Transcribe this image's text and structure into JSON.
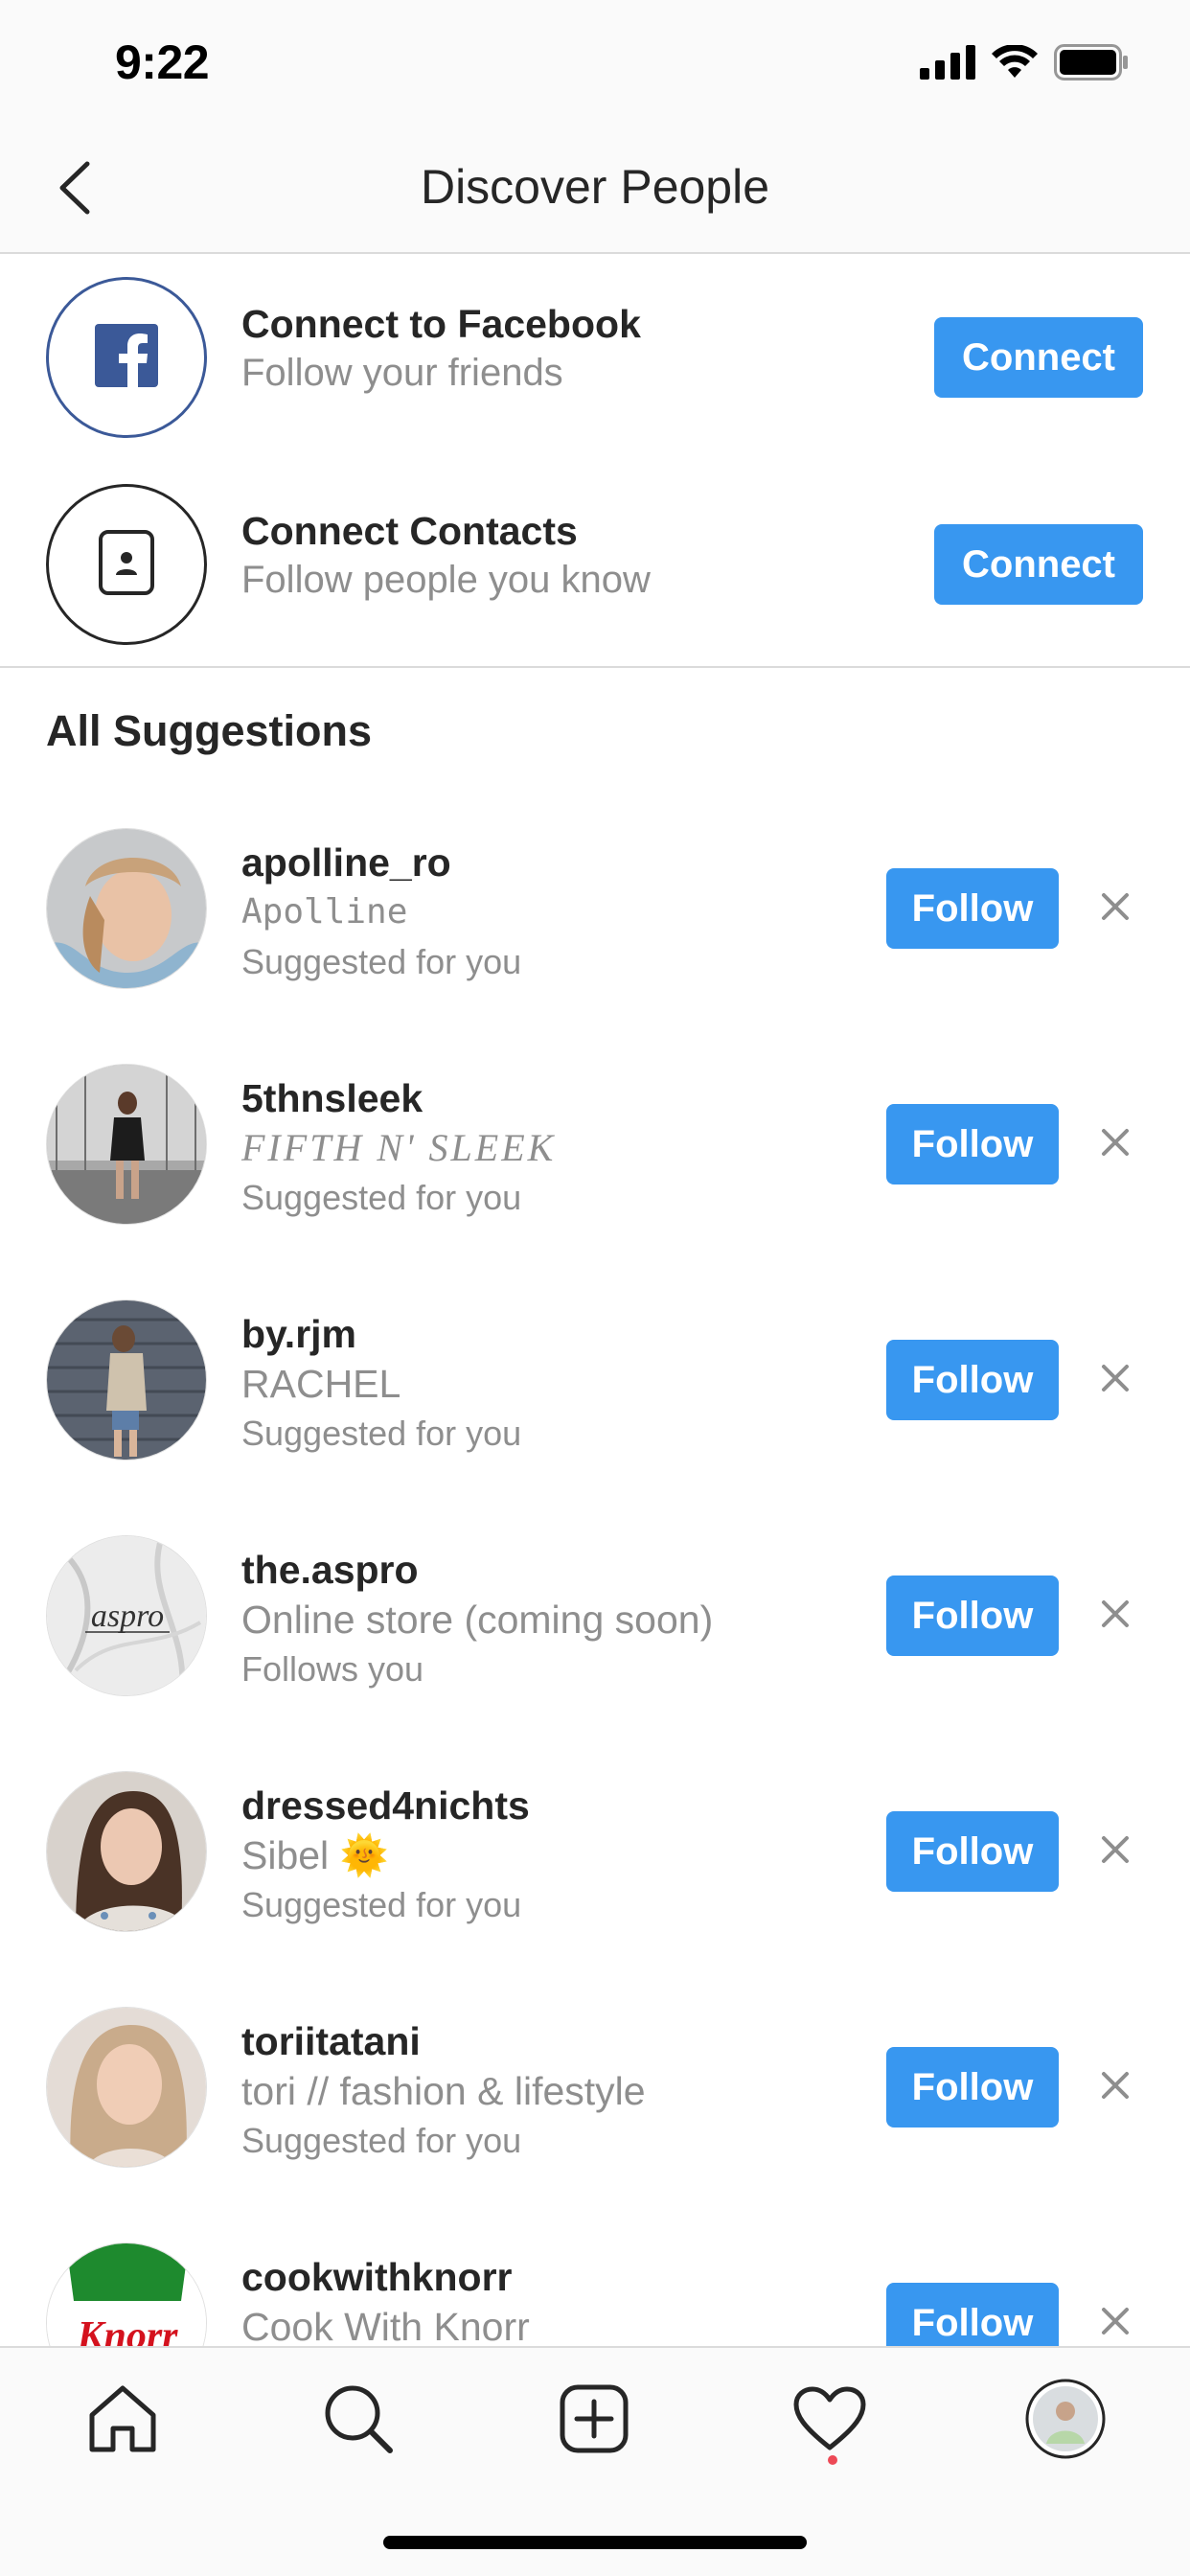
{
  "status_bar": {
    "time": "9:22"
  },
  "header": {
    "title": "Discover People"
  },
  "connect": [
    {
      "title": "Connect to Facebook",
      "subtitle": "Follow your friends",
      "button": "Connect",
      "icon": "facebook-icon"
    },
    {
      "title": "Connect Contacts",
      "subtitle": "Follow people you know",
      "button": "Connect",
      "icon": "contacts-icon"
    }
  ],
  "suggestions_title": "All Suggestions",
  "suggestions": [
    {
      "username": "apolline_ro",
      "name": "Apolline",
      "reason": "Suggested for you",
      "button": "Follow"
    },
    {
      "username": "5thnsleek",
      "name": "FIFTH N' SLEEK",
      "reason": "Suggested for you",
      "button": "Follow"
    },
    {
      "username": "by.rjm",
      "name": "RACHEL",
      "reason": "Suggested for you",
      "button": "Follow"
    },
    {
      "username": "the.aspro",
      "name": "Online store (coming soon)",
      "reason": "Follows you",
      "button": "Follow",
      "avatar_text": "aspro"
    },
    {
      "username": "dressed4nichts",
      "name": "Sibel 🌞",
      "reason": "Suggested for you",
      "button": "Follow"
    },
    {
      "username": "toriitatani",
      "name": "tori // fashion & lifestyle",
      "reason": "Suggested for you",
      "button": "Follow"
    },
    {
      "username": "cookwithknorr",
      "name": "Cook With Knorr",
      "reason": "",
      "button": "Follow",
      "avatar_text": "Knorr"
    }
  ],
  "tabs": [
    "home-icon",
    "search-icon",
    "new-post-icon",
    "activity-heart-icon",
    "profile-avatar"
  ],
  "colors": {
    "accent": "#3897f0",
    "facebook": "#3b5998",
    "notification_dot": "#ed4956"
  }
}
